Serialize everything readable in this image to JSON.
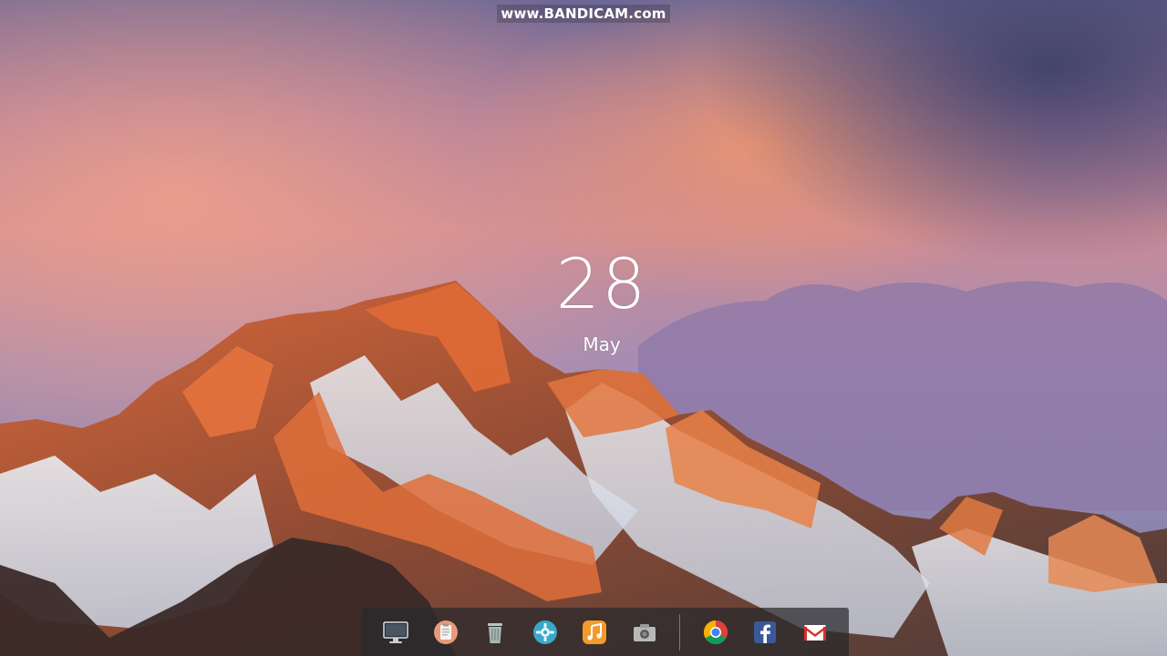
{
  "watermark": {
    "text": "www.BANDICAM.com"
  },
  "clock": {
    "day": "28",
    "month": "May"
  },
  "dock": {
    "items": [
      {
        "name": "monitor-icon",
        "color": "#d8dde4"
      },
      {
        "name": "clipboard-icon",
        "color": "#e79a7a"
      },
      {
        "name": "trash-icon",
        "color": "#a9b8b2"
      },
      {
        "name": "settings-icon",
        "color": "#3aa8c8"
      },
      {
        "name": "music-icon",
        "color": "#f39a2a"
      },
      {
        "name": "camera-icon",
        "color": "#b8b8b8"
      },
      {
        "name": "chrome-icon",
        "color": "#4285f4"
      },
      {
        "name": "facebook-icon",
        "color": "#3b5998"
      },
      {
        "name": "gmail-icon",
        "color": "#d93025"
      }
    ]
  }
}
